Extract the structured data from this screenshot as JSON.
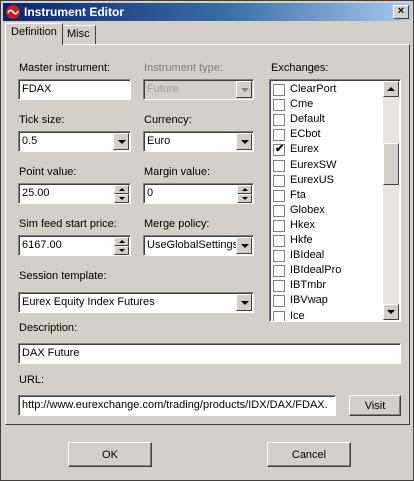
{
  "window": {
    "title": "Instrument Editor",
    "close_glyph": "×"
  },
  "tabs": [
    {
      "label": "Definition",
      "active": true
    },
    {
      "label": "Misc",
      "active": false
    }
  ],
  "form": {
    "master_instrument": {
      "label": "Master instrument:",
      "value": "FDAX"
    },
    "instrument_type": {
      "label": "Instrument type:",
      "value": "Future",
      "disabled": true
    },
    "tick_size": {
      "label": "Tick size:",
      "value": "0.5"
    },
    "currency": {
      "label": "Currency:",
      "value": "Euro"
    },
    "point_value": {
      "label": "Point value:",
      "value": "25.00"
    },
    "margin_value": {
      "label": "Margin value:",
      "value": "0"
    },
    "sim_feed_start_price": {
      "label": "Sim feed start price:",
      "value": "6167.00"
    },
    "merge_policy": {
      "label": "Merge policy:",
      "value": "UseGlobalSettings"
    },
    "session_template": {
      "label": "Session template:",
      "value": "Eurex Equity Index Futures"
    },
    "description": {
      "label": "Description:",
      "value": "DAX Future"
    },
    "url": {
      "label": "URL:",
      "value": "http://www.eurexchange.com/trading/products/IDX/DAX/FDAX.",
      "visit_label": "Visit"
    }
  },
  "exchanges": {
    "label": "Exchanges:",
    "items": [
      {
        "name": "ClearPort",
        "checked": false
      },
      {
        "name": "Cme",
        "checked": false
      },
      {
        "name": "Default",
        "checked": false
      },
      {
        "name": "ECbot",
        "checked": false
      },
      {
        "name": "Eurex",
        "checked": true
      },
      {
        "name": "EurexSW",
        "checked": false
      },
      {
        "name": "EurexUS",
        "checked": false
      },
      {
        "name": "Fta",
        "checked": false
      },
      {
        "name": "Globex",
        "checked": false
      },
      {
        "name": "Hkex",
        "checked": false
      },
      {
        "name": "Hkfe",
        "checked": false
      },
      {
        "name": "IBIdeal",
        "checked": false
      },
      {
        "name": "IBIdealPro",
        "checked": false
      },
      {
        "name": "IBTmbr",
        "checked": false
      },
      {
        "name": "IBVwap",
        "checked": false
      },
      {
        "name": "Ice",
        "checked": false
      }
    ]
  },
  "footer": {
    "ok_label": "OK",
    "cancel_label": "Cancel"
  }
}
